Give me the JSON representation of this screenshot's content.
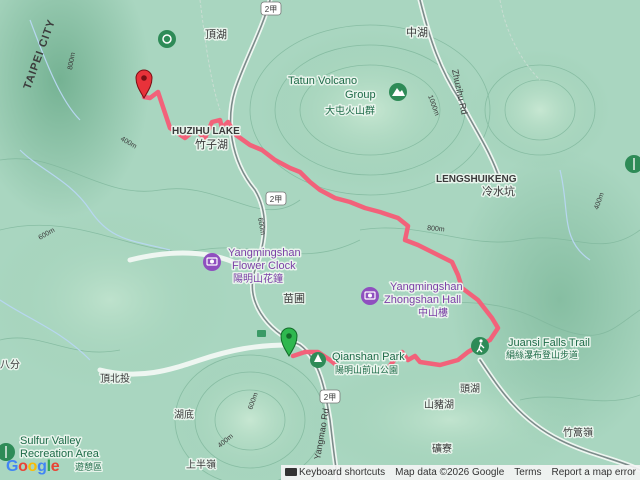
{
  "map": {
    "labels": {
      "taipei_city": "TAIPEI CITY",
      "dingtian": "頂湖",
      "zhonghu": "中湖",
      "zhuzihu_en": "HUZIHU LAKE",
      "zhuzihu_zh": "竹子湖",
      "tatun_en1": "Tatun Volcano",
      "tatun_en2": "Group",
      "tatun_zh": "大屯火山群",
      "zhuzihu_rd": "Zhuzihu Rd",
      "lengshuikeng_en": "LENGSHUIKENG",
      "lengshuikeng_zh": "冷水坑",
      "flower_clock_en1": "Yangmingshan",
      "flower_clock_en2": "Flower Clock",
      "flower_clock_zh": "陽明山花鐘",
      "zhongshan_en1": "Yangmingshan",
      "zhongshan_en2": "Zhongshan Hall",
      "zhongshan_zh": "中山樓",
      "miaopu": "苗圃",
      "juansi_en": "Juansi Falls Trail",
      "juansi_zh": "絹絲瀑布登山步道",
      "qianshan_en": "Qianshan Park",
      "qianshan_zh": "陽明山前山公園",
      "dingbeitou": "頂北投",
      "hudi": "湖底",
      "shanzhuhu": "山豬湖",
      "touhu": "頭湖",
      "zhuzaihu": "竹篙嶺",
      "kuangliao": "礦寮",
      "shangbanling": "上半嶺",
      "bafen": "八分",
      "sulfur_en1": "Sulfur Valley",
      "sulfur_en2": "Recreation Area",
      "sulfur_zh": "遊憩區",
      "yangjin_rd": "Yangmao Rd",
      "route_2": "2甲",
      "contour_600": "600m",
      "contour_800": "800m",
      "contour_400": "400m",
      "contour_1000": "1000m"
    },
    "icons": {
      "start_marker": "green-pin-icon",
      "end_marker": "red-pin-icon",
      "attraction": "camera-icon",
      "park": "tree-icon",
      "peak": "mountain-icon",
      "trail": "hiker-icon"
    },
    "colors": {
      "route": "#f2627a",
      "terrain": "#a9d6c0",
      "road": "#7c8b8a",
      "water": "#b7d7f0",
      "poi_purple": "#8f4fbf",
      "park_green": "#2e8b57"
    }
  },
  "branding": {
    "google_logo": "Google"
  },
  "attribution": {
    "shortcuts": "Keyboard shortcuts",
    "map_data": "Map data ©2026 Google",
    "terms": "Terms",
    "report": "Report a map error"
  }
}
